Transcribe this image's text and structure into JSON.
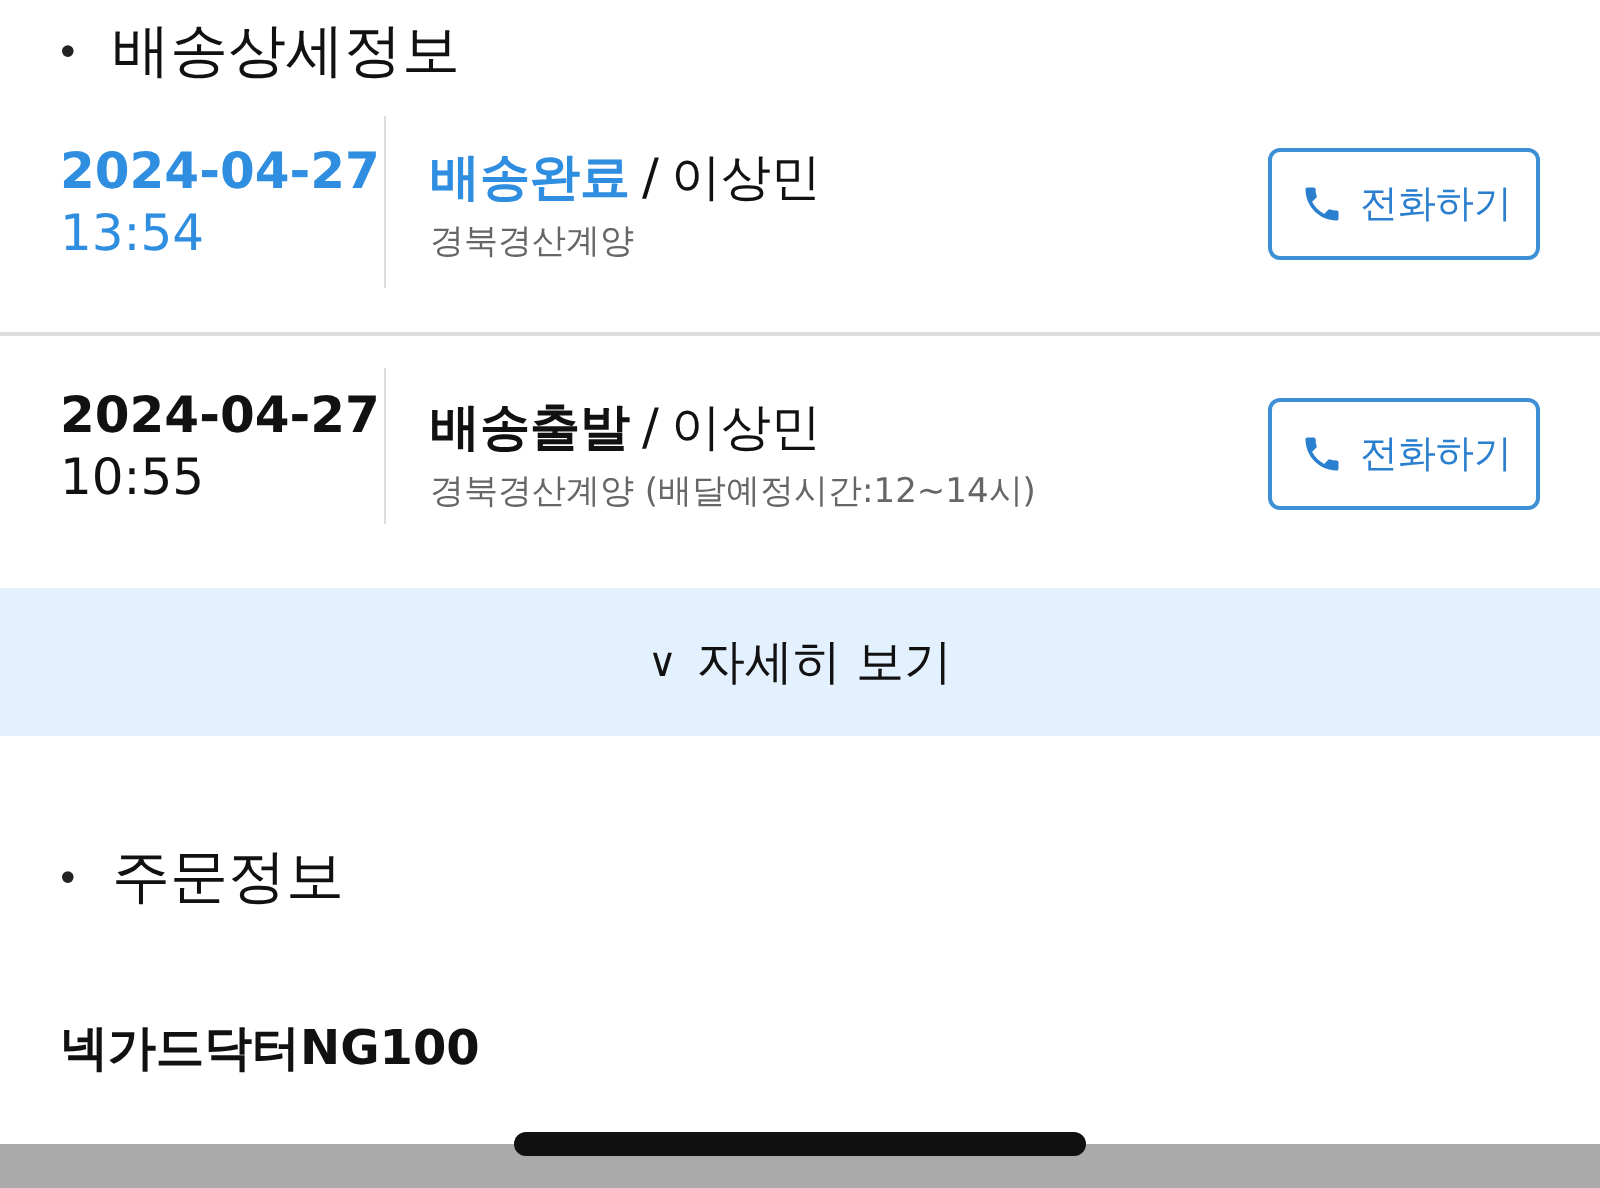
{
  "delivery_section": {
    "bullet": "•",
    "title": "배송상세정보"
  },
  "events": [
    {
      "date": "2024-04-27",
      "time": "13:54",
      "status": "배송완료",
      "separator": "/",
      "courier": "이상민",
      "location": "경북경산계양",
      "latest": true,
      "call_button": "전화하기"
    },
    {
      "date": "2024-04-27",
      "time": "10:55",
      "status": "배송출발",
      "separator": "/",
      "courier": "이상민",
      "location": "경북경산계양 (배달예정시간:12~14시)",
      "latest": false,
      "call_button": "전화하기"
    }
  ],
  "more_button": {
    "icon": "∨",
    "label": "자세히 보기"
  },
  "order_section": {
    "bullet": "•",
    "title": "주문정보"
  },
  "product_name": "넥가드닥터NG100"
}
